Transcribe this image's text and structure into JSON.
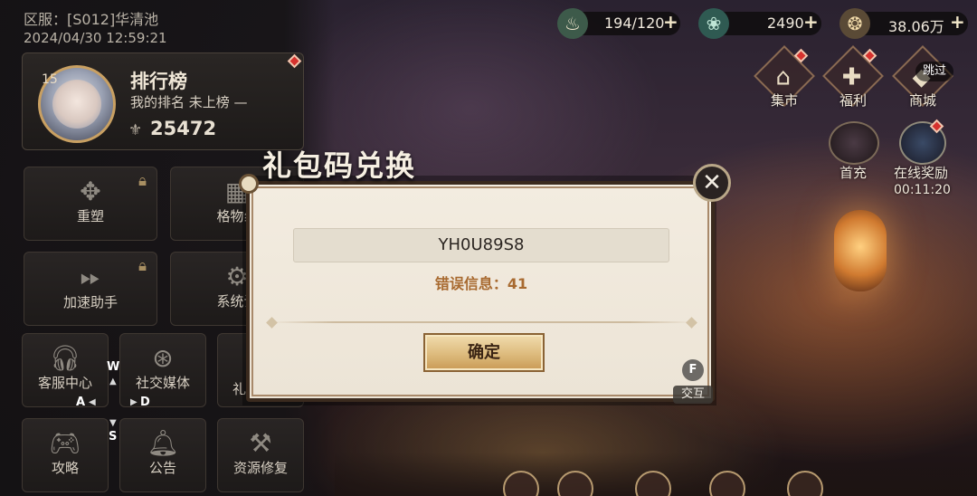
{
  "status": {
    "server": "区服：[S012]华清池",
    "datetime": "2024/04/30 12:59:21"
  },
  "rank_card": {
    "level": "15",
    "title": "排行榜",
    "my_rank": "我的排名 未上榜 —",
    "power": "25472"
  },
  "left_menu": {
    "reshape": "重塑",
    "gewu": "格物纟",
    "speed_assist": "加速助手",
    "system_settings": "系统设",
    "customer_service": "客服中心",
    "social_media": "社交媒体",
    "gift_partial": "礼",
    "guide": "攻略",
    "announcement": "公告",
    "repair": "资源修复"
  },
  "wasd": {
    "w": "W",
    "a": "A",
    "s": "S",
    "d": "D"
  },
  "resources": {
    "stamina": "194/120",
    "jade": "2490",
    "coins": "38.06万"
  },
  "right_nav": {
    "market": "集市",
    "welfare": "福利",
    "shop": "商城",
    "skip": "跳过",
    "first_recharge": "首充",
    "online_reward": "在线奖励",
    "online_timer": "00:11:20"
  },
  "modal": {
    "title": "礼包码兑换",
    "code_value": "YH0U89S8",
    "error_text": "错误信息：41",
    "confirm_label": "确定",
    "close_glyph": "✕"
  },
  "hotkeys": {
    "f_key": "F",
    "interact": "交互"
  }
}
